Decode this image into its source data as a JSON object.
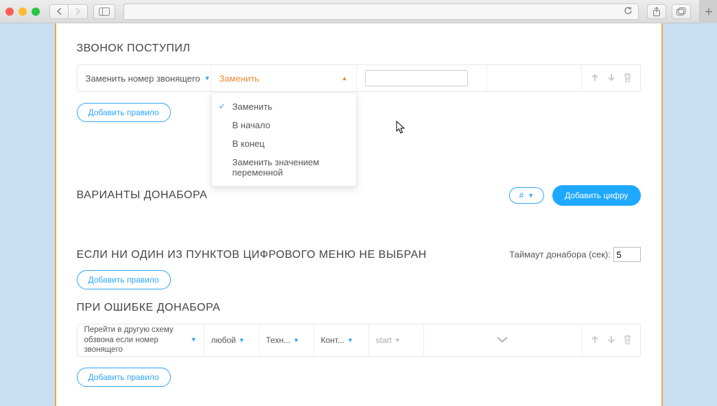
{
  "sections": {
    "incoming": "ЗВОНОК ПОСТУПИЛ",
    "variants": "ВАРИАНТЫ ДОНАБОРА",
    "no_option": "ЕСЛИ НИ ОДИН ИЗ ПУНКТОВ ЦИФРОВОГО МЕНЮ НЕ ВЫБРАН",
    "on_error": "ПРИ ОШИБКЕ ДОНАБОРА"
  },
  "rule1": {
    "select1": "Заменить номер звонящего",
    "select2": "Заменить",
    "value": ""
  },
  "dropdown": {
    "options": [
      "Заменить",
      "В начало",
      "В конец",
      "Заменить значением переменной"
    ],
    "selected_index": 0
  },
  "buttons": {
    "add_rule": "Добавить правило",
    "add_digit": "Добавить цифру",
    "hash": "#"
  },
  "timeout": {
    "label": "Таймаут донабора (сек):",
    "value": "5"
  },
  "err_rule": {
    "scheme": "Перейти в другую схему обзвона если номер звонящего",
    "match": "любой",
    "col3": "Техн...",
    "col4": "Конт...",
    "col5": "start"
  }
}
